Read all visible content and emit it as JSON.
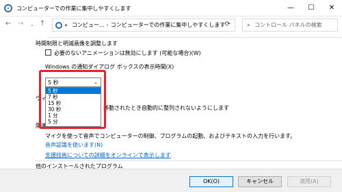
{
  "window": {
    "title": "コンピューターでの作業に集中しやすくします",
    "controls": {
      "minimize": "—",
      "maximize": "☐",
      "close": "✕"
    }
  },
  "address": {
    "back": "←",
    "forward": "→",
    "recent": "⌄",
    "up": "↑",
    "overflow": "«",
    "crumb1": "コンピュー...",
    "separator": "›",
    "crumb2": "コンピューターでの作業に集中しやすくします",
    "dropdown": "⌄",
    "refresh": "⟳",
    "search_placeholder": "コントロール パネルの検索"
  },
  "sections": {
    "time_limits_heading": "時間制限と明滅画像を調整します",
    "animation_checkbox": "必要のないアニメーションは無効にします (可能な場合)(W)",
    "notification_label": "Windows の通知ダイアログ ボックスの表示時間(X)",
    "window_heading_partial": "ウィン",
    "auto_arrange_text": "移動されたとき自動的に整列されないようにします",
    "related_heading_partial": "関連",
    "speech_text": "マイクを使って音声でコンピューターの制御、プログラムの起動、およびテキストの入力を行います。",
    "speech_link": "音声認識を使います(N)",
    "assistive_link": "支援技術についての詳細をオンラインで表示します",
    "other_programs_heading": "他のインストールされたプログラム"
  },
  "dropdown": {
    "selected": "5 秒",
    "caret": "⌄",
    "options": [
      "5 秒",
      "7 秒",
      "15 秒",
      "30 秒",
      "1 分",
      "5 分"
    ],
    "highlighted_index": 0
  },
  "buttons": {
    "ok": "OK(O)",
    "cancel": "キャンセル",
    "apply": "適用(A)"
  },
  "colors": {
    "accent": "#0078d7",
    "link": "#0066cc",
    "highlight_box": "#e8202a"
  }
}
